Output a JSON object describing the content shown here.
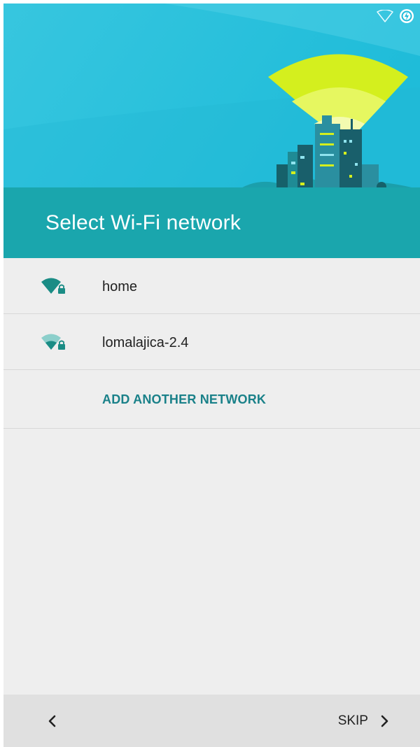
{
  "header": {
    "title": "Select Wi-Fi network",
    "colors": {
      "sky": "#2ec3de",
      "band": "#1aa6ad",
      "beam": "#d4ef1e"
    }
  },
  "status_bar": {
    "icons": [
      "wifi-outline-icon",
      "battery-charging-icon"
    ]
  },
  "networks": [
    {
      "ssid": "home",
      "signal": "full",
      "secured": true,
      "icon": "wifi-lock-icon"
    },
    {
      "ssid": "lomalajica-2.4",
      "signal": "weak",
      "secured": true,
      "icon": "wifi-lock-icon"
    }
  ],
  "add_network": {
    "label": "ADD ANOTHER NETWORK",
    "color": "#1a8189"
  },
  "bottom_nav": {
    "back_icon": "chevron-left-icon",
    "skip_label": "SKIP",
    "skip_icon": "chevron-right-icon"
  }
}
